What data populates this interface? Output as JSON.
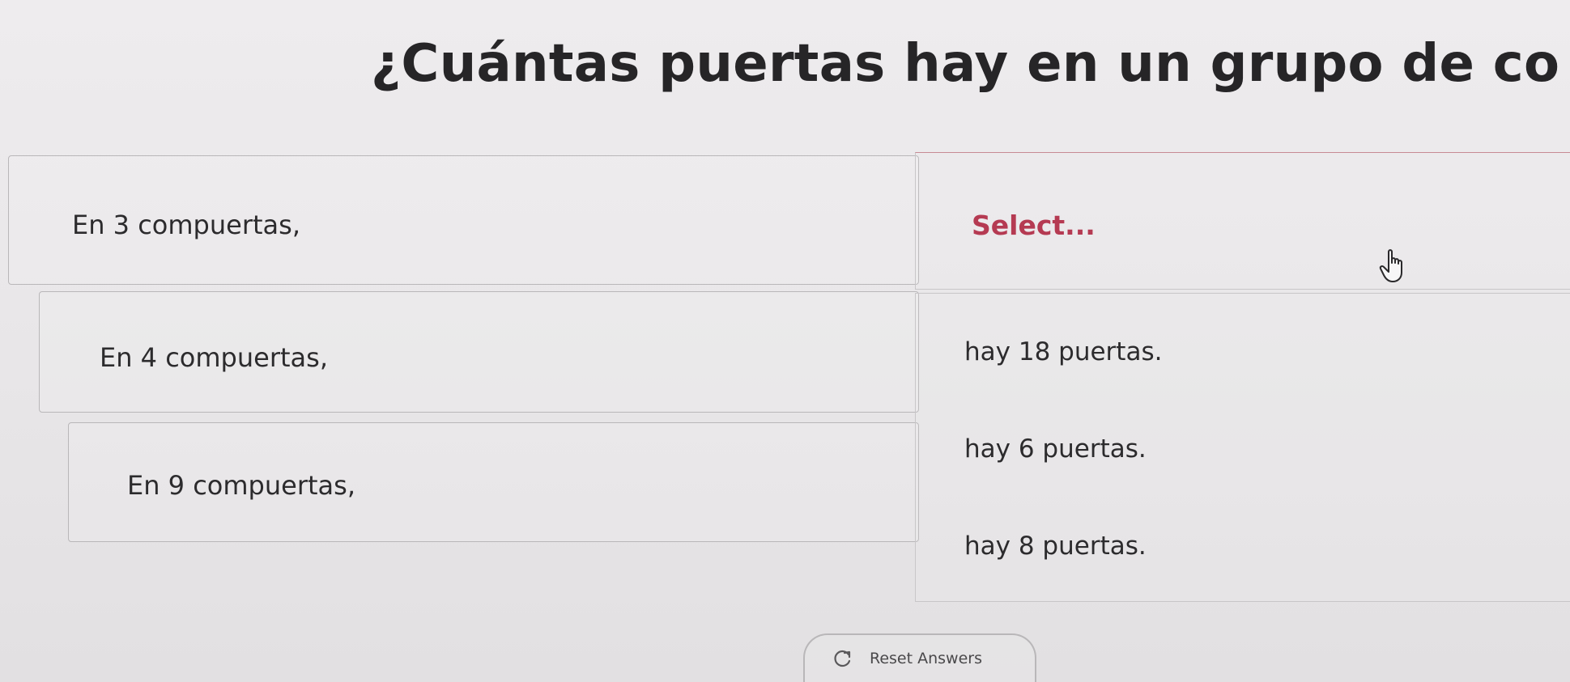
{
  "question": "¿Cuántas puertas hay en un grupo de compuertas?",
  "rows": [
    {
      "label": "En 3 compuertas,"
    },
    {
      "label": "En 4 compuertas,"
    },
    {
      "label": "En 9 compuertas,"
    }
  ],
  "select": {
    "placeholder": "Select...",
    "accent_color": "#b53a52"
  },
  "options": [
    {
      "label": "hay 18 puertas."
    },
    {
      "label": "hay 6 puertas."
    },
    {
      "label": "hay 8 puertas."
    }
  ],
  "reset": {
    "label": "Reset Answers",
    "icon": "refresh-icon"
  },
  "cursor": {
    "icon": "hand-pointer-icon"
  }
}
